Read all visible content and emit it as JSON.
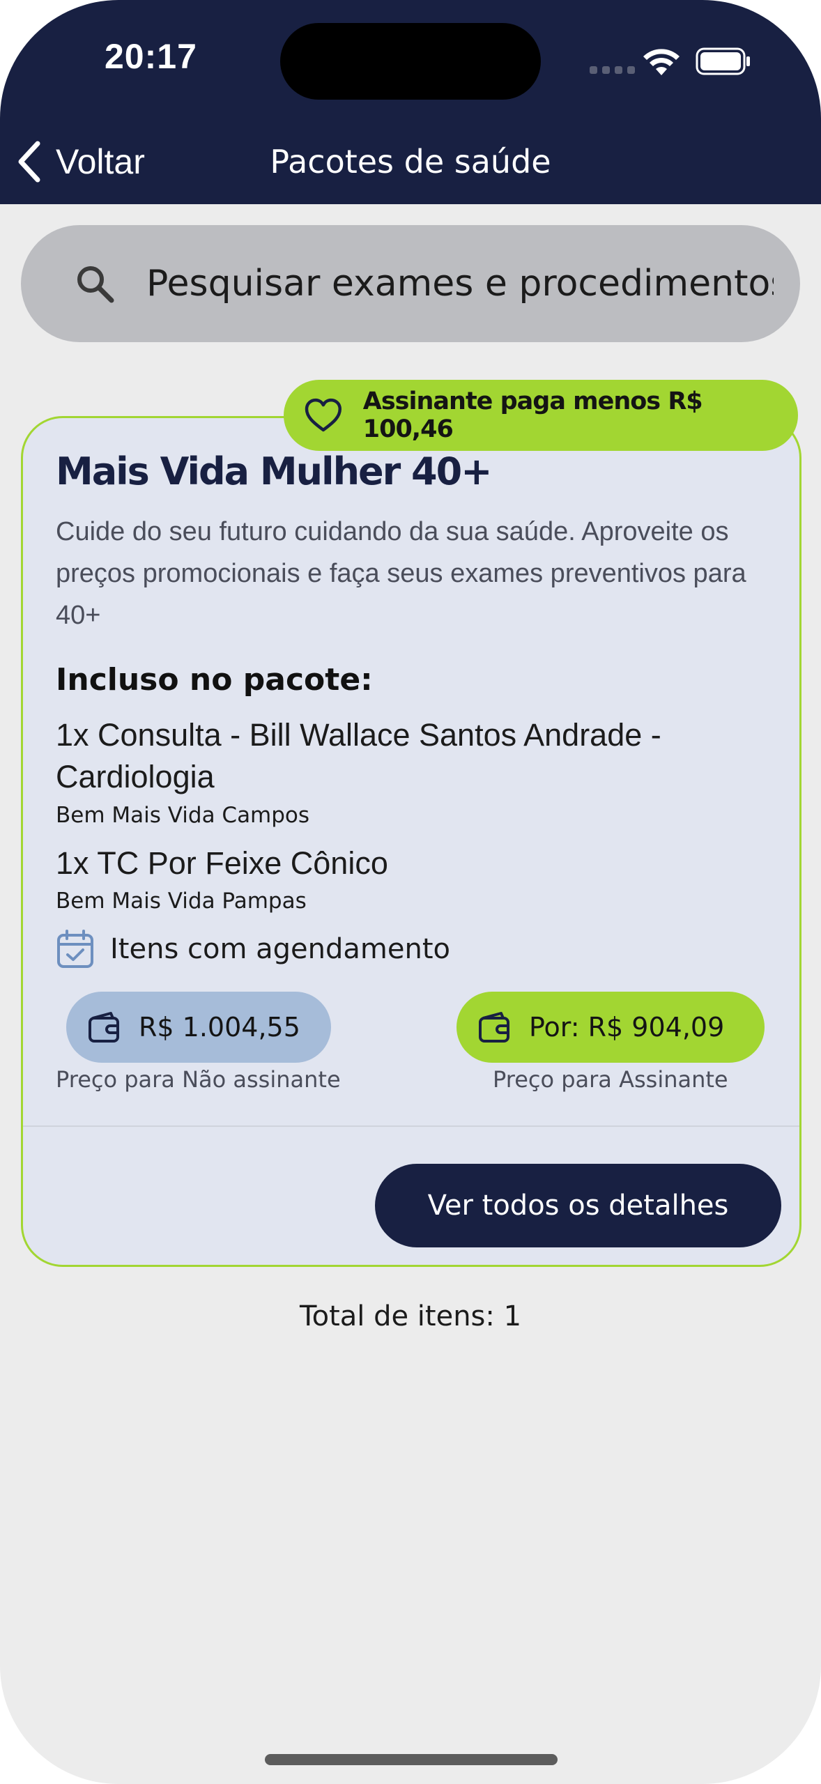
{
  "status_bar": {
    "time": "20:17",
    "icons": [
      "signal-icon",
      "wifi-icon",
      "battery-icon"
    ]
  },
  "nav": {
    "back_label": "Voltar",
    "title": "Pacotes de saúde"
  },
  "search": {
    "placeholder": "Pesquisar exames e procedimentos"
  },
  "package": {
    "savings_badge": "Assinante paga menos R$ 100,46",
    "title": "Mais Vida Mulher 40+",
    "description": "Cuide do seu futuro cuidando da sua saúde. Aproveite os preços promocionais e faça seus exames preventivos para 40+",
    "included_heading": "Incluso no pacote:",
    "items": [
      {
        "name": "1x Consulta - Bill Wallace Santos Andrade - Cardiologia",
        "location": "Bem Mais Vida Campos"
      },
      {
        "name": "1x TC Por Feixe Cônico",
        "location": "Bem Mais Vida Pampas"
      }
    ],
    "schedule_note": "Itens com agendamento",
    "price_non_subscriber": "R$ 1.004,55",
    "price_non_subscriber_caption": "Preço para Não assinante",
    "price_subscriber": "Por: R$ 904,09",
    "price_subscriber_caption": "Preço para Assinante",
    "details_button": "Ver todos os detalhes"
  },
  "footer": {
    "total_items": "Total de itens: 1"
  },
  "colors": {
    "navy": "#182042",
    "lime": "#a2d632",
    "card_bg": "#e1e5f0",
    "nonsub_pill": "#a6bcd9",
    "search_bg": "#bcbdc1"
  }
}
